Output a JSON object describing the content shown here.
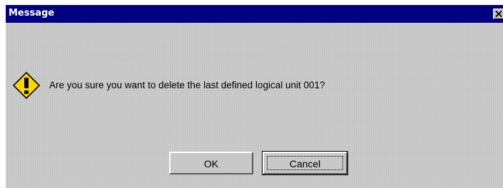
{
  "window": {
    "title": "Message",
    "close_icon": "close-icon"
  },
  "dialog": {
    "icon": "warning-exclamation-icon",
    "message": "Are you sure you want to delete the last defined logical unit 001?"
  },
  "buttons": {
    "ok_label": "OK",
    "cancel_label": "Cancel",
    "focused": "Cancel"
  },
  "colors": {
    "titlebar": "#000080",
    "dialog_bg": "#c8c8c8",
    "icon_fill": "#ffd700"
  }
}
